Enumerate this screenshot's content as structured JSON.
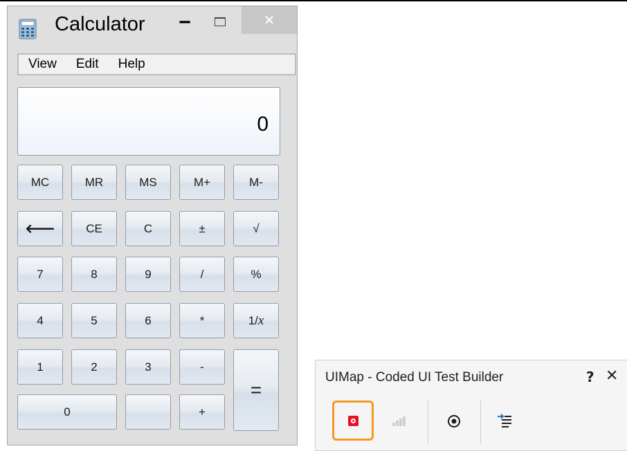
{
  "calculator": {
    "title": "Calculator",
    "window_controls": {
      "minimize": "‒",
      "close": "✕"
    },
    "menu": [
      "View",
      "Edit",
      "Help"
    ],
    "display_value": "0",
    "keys": {
      "mc": "MC",
      "mr": "MR",
      "ms": "MS",
      "m_plus": "M+",
      "m_minus": "M-",
      "backspace": "⟵",
      "ce": "CE",
      "c": "C",
      "plus_minus": "±",
      "sqrt": "√",
      "d7": "7",
      "d8": "8",
      "d9": "9",
      "divide": "/",
      "percent": "%",
      "d4": "4",
      "d5": "5",
      "d6": "6",
      "multiply": "*",
      "reciprocal_prefix": "1/",
      "reciprocal_var": "x",
      "d1": "1",
      "d2": "2",
      "d3": "3",
      "subtract": "-",
      "equals": "=",
      "d0": "0",
      "decimal": "",
      "add": "+"
    },
    "colors": {
      "close_button": "#c7c7c7",
      "key_border": "#8e9cae"
    }
  },
  "builder": {
    "title": "UIMap - Coded UI Test Builder",
    "help": "?",
    "close": "✕",
    "tools": [
      "record-icon",
      "pause-icon",
      "crosshair-icon",
      "generate-code-icon"
    ],
    "colors": {
      "record_highlight": "#f39a1f",
      "record": "#e81123",
      "generate_arrow": "#1e78c8"
    }
  }
}
